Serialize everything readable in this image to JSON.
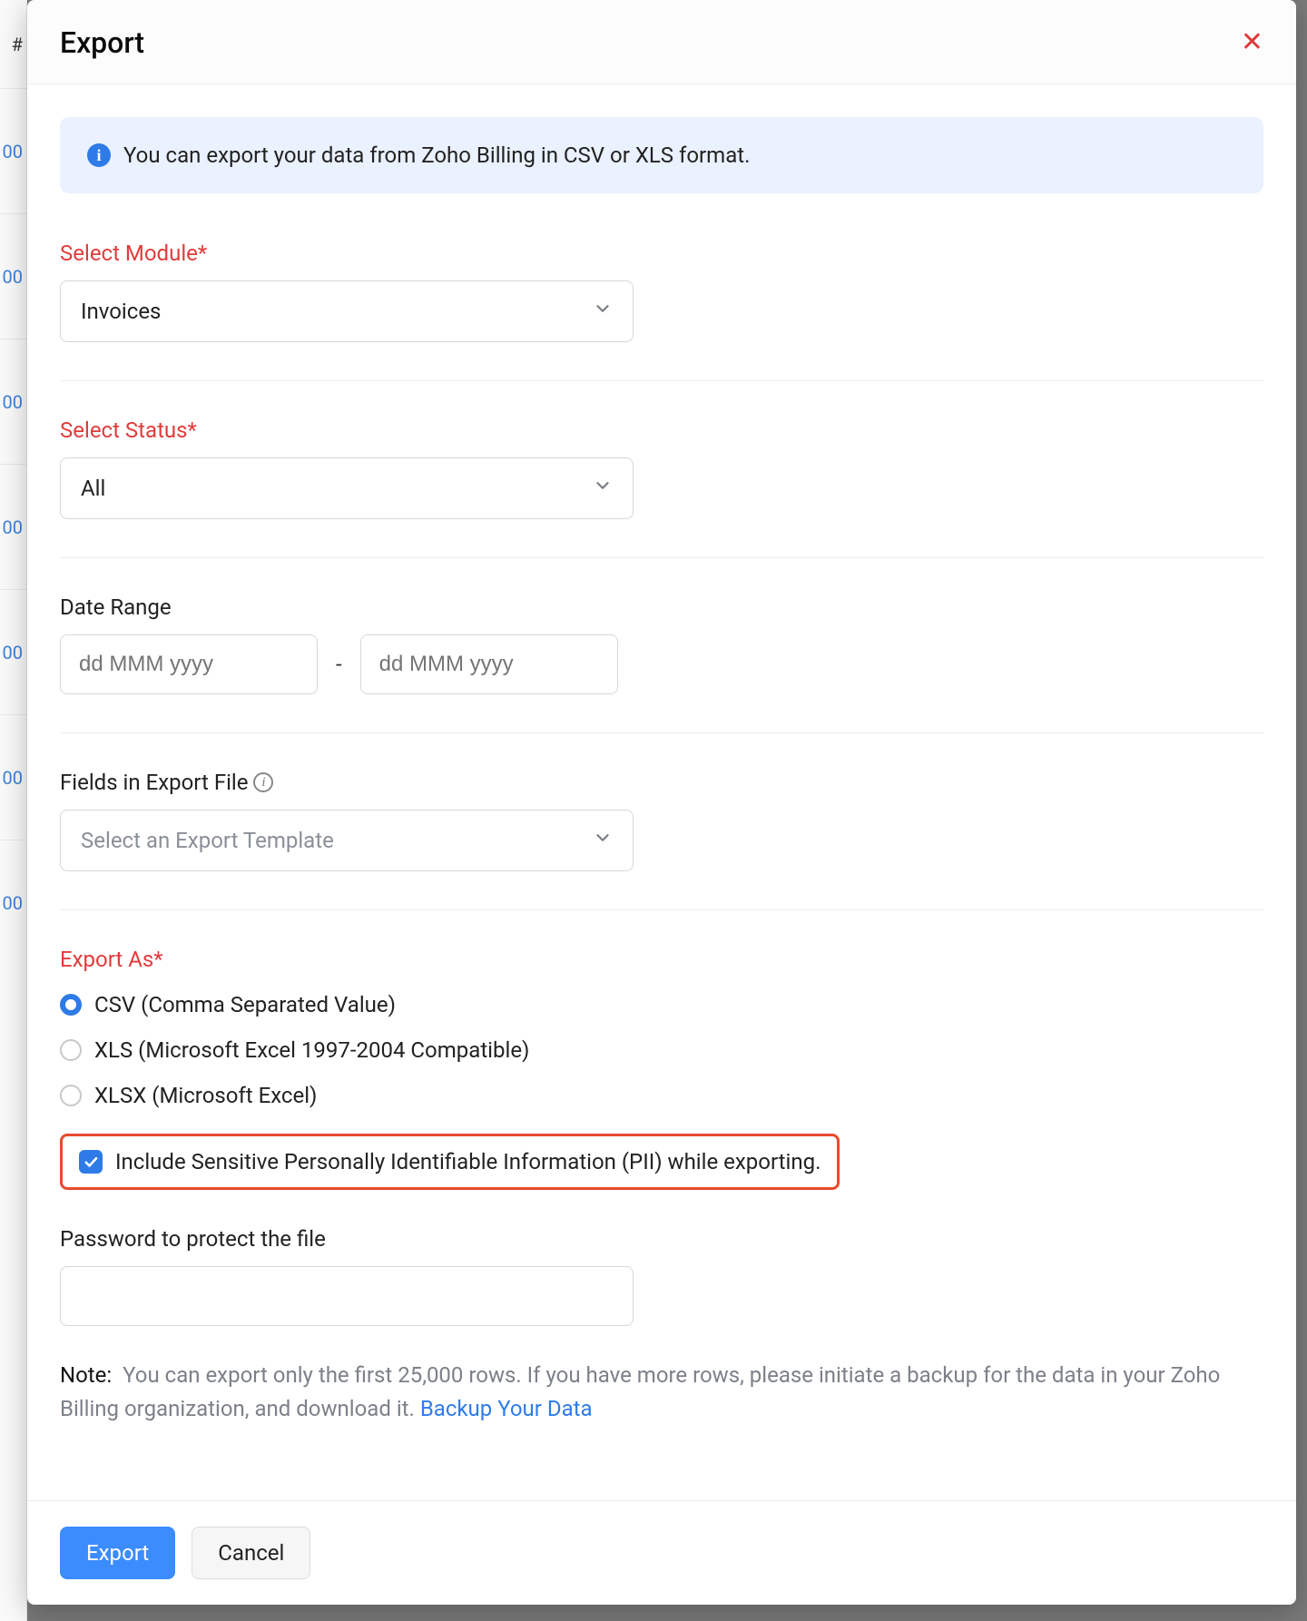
{
  "backdrop": {
    "row_text": "00",
    "header_text": "#"
  },
  "header": {
    "title": "Export"
  },
  "banner": {
    "text": "You can export your data from Zoho Billing in CSV or XLS format."
  },
  "module": {
    "label": "Select Module*",
    "value": "Invoices"
  },
  "status": {
    "label": "Select Status*",
    "value": "All"
  },
  "date_range": {
    "label": "Date Range",
    "placeholder_from": "dd MMM yyyy",
    "placeholder_to": "dd MMM yyyy",
    "separator": "-"
  },
  "fields": {
    "label": "Fields in Export File",
    "placeholder": "Select an Export Template"
  },
  "export_as": {
    "label": "Export As*",
    "options": [
      {
        "label": "CSV (Comma Separated Value)",
        "checked": true
      },
      {
        "label": "XLS (Microsoft Excel 1997-2004 Compatible)",
        "checked": false
      },
      {
        "label": "XLSX (Microsoft Excel)",
        "checked": false
      }
    ]
  },
  "pii": {
    "label": "Include Sensitive Personally Identifiable Information (PII) while exporting.",
    "checked": true
  },
  "password": {
    "label": "Password to protect the file",
    "value": ""
  },
  "note": {
    "prefix": "Note:",
    "text": "You can export only the first 25,000 rows. If you have more rows, please initiate a backup for the data in your Zoho Billing organization, and download it.",
    "link": "Backup Your Data"
  },
  "footer": {
    "export": "Export",
    "cancel": "Cancel"
  }
}
